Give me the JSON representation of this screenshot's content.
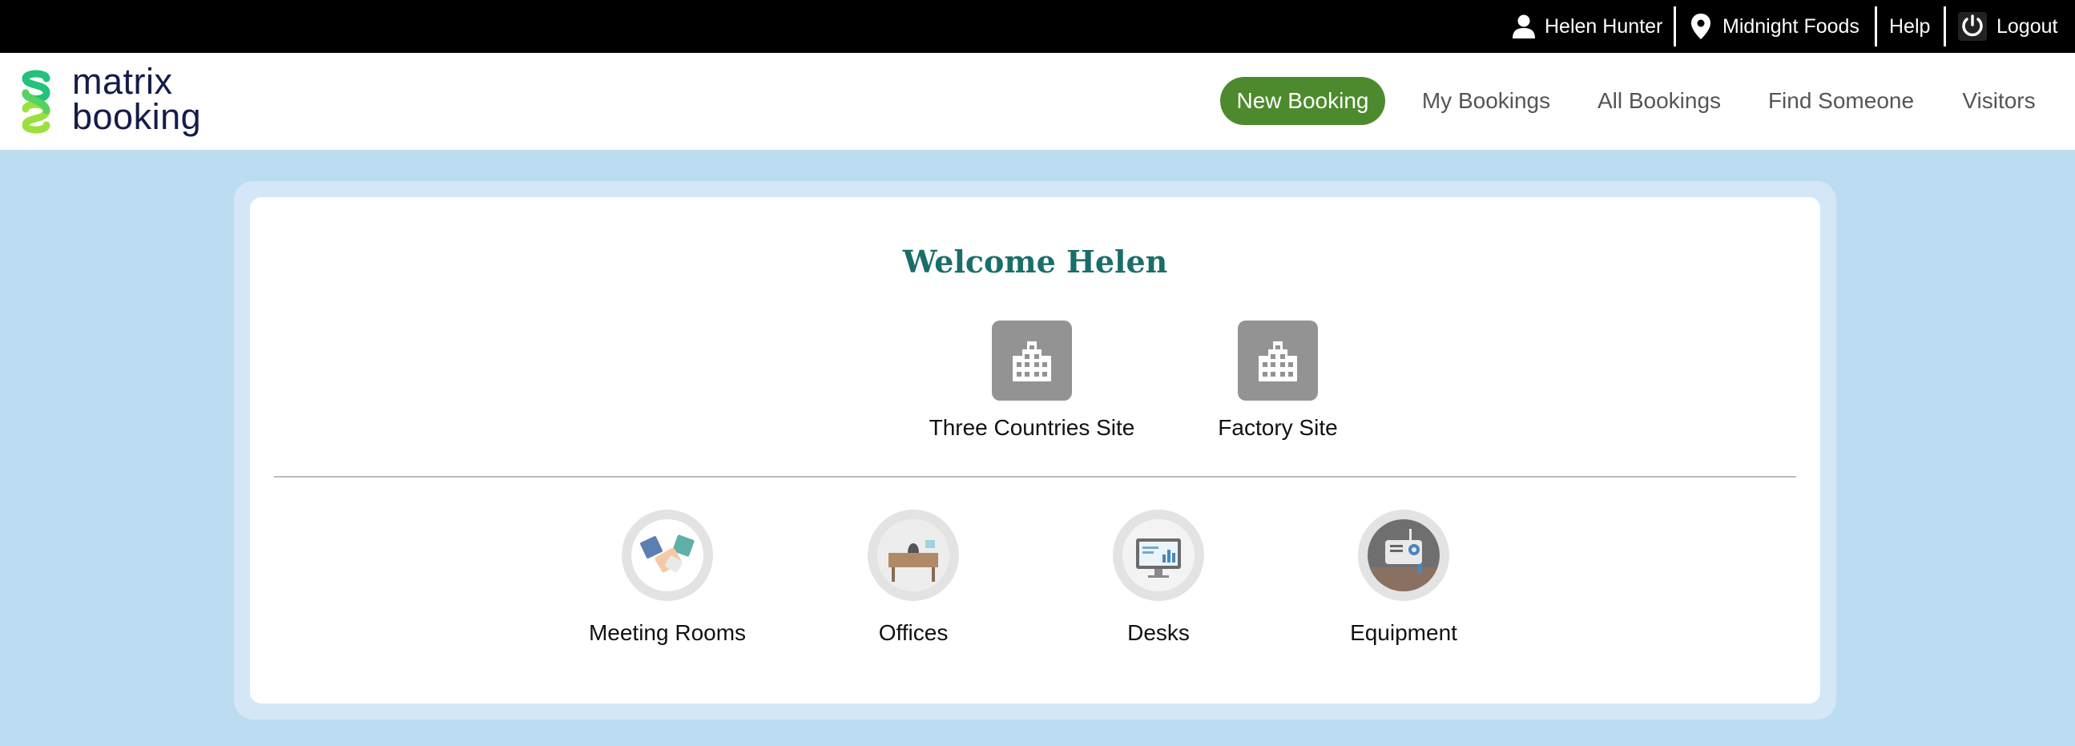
{
  "topbar": {
    "user": "Helen Hunter",
    "organisation": "Midnight Foods",
    "help": "Help",
    "logout": "Logout"
  },
  "header": {
    "logo_line1": "matrix",
    "logo_line2": "booking",
    "nav": [
      {
        "label": "New Booking",
        "active": true
      },
      {
        "label": "My Bookings"
      },
      {
        "label": "All Bookings"
      },
      {
        "label": "Find Someone"
      },
      {
        "label": "Visitors"
      }
    ]
  },
  "main": {
    "welcome": "Welcome Helen",
    "sites": [
      {
        "label": "Three Countries Site",
        "icon": "building-icon"
      },
      {
        "label": "Factory Site",
        "icon": "building-icon"
      }
    ],
    "categories": [
      {
        "label": "Meeting Rooms",
        "icon": "meeting-rooms-icon"
      },
      {
        "label": "Offices",
        "icon": "offices-icon"
      },
      {
        "label": "Desks",
        "icon": "desks-icon"
      },
      {
        "label": "Equipment",
        "icon": "equipment-icon"
      }
    ]
  },
  "colors": {
    "accent": "#4d8a2d",
    "welcome": "#1a6e6a",
    "background": "#bcdcf1",
    "site_tile": "#939393"
  }
}
